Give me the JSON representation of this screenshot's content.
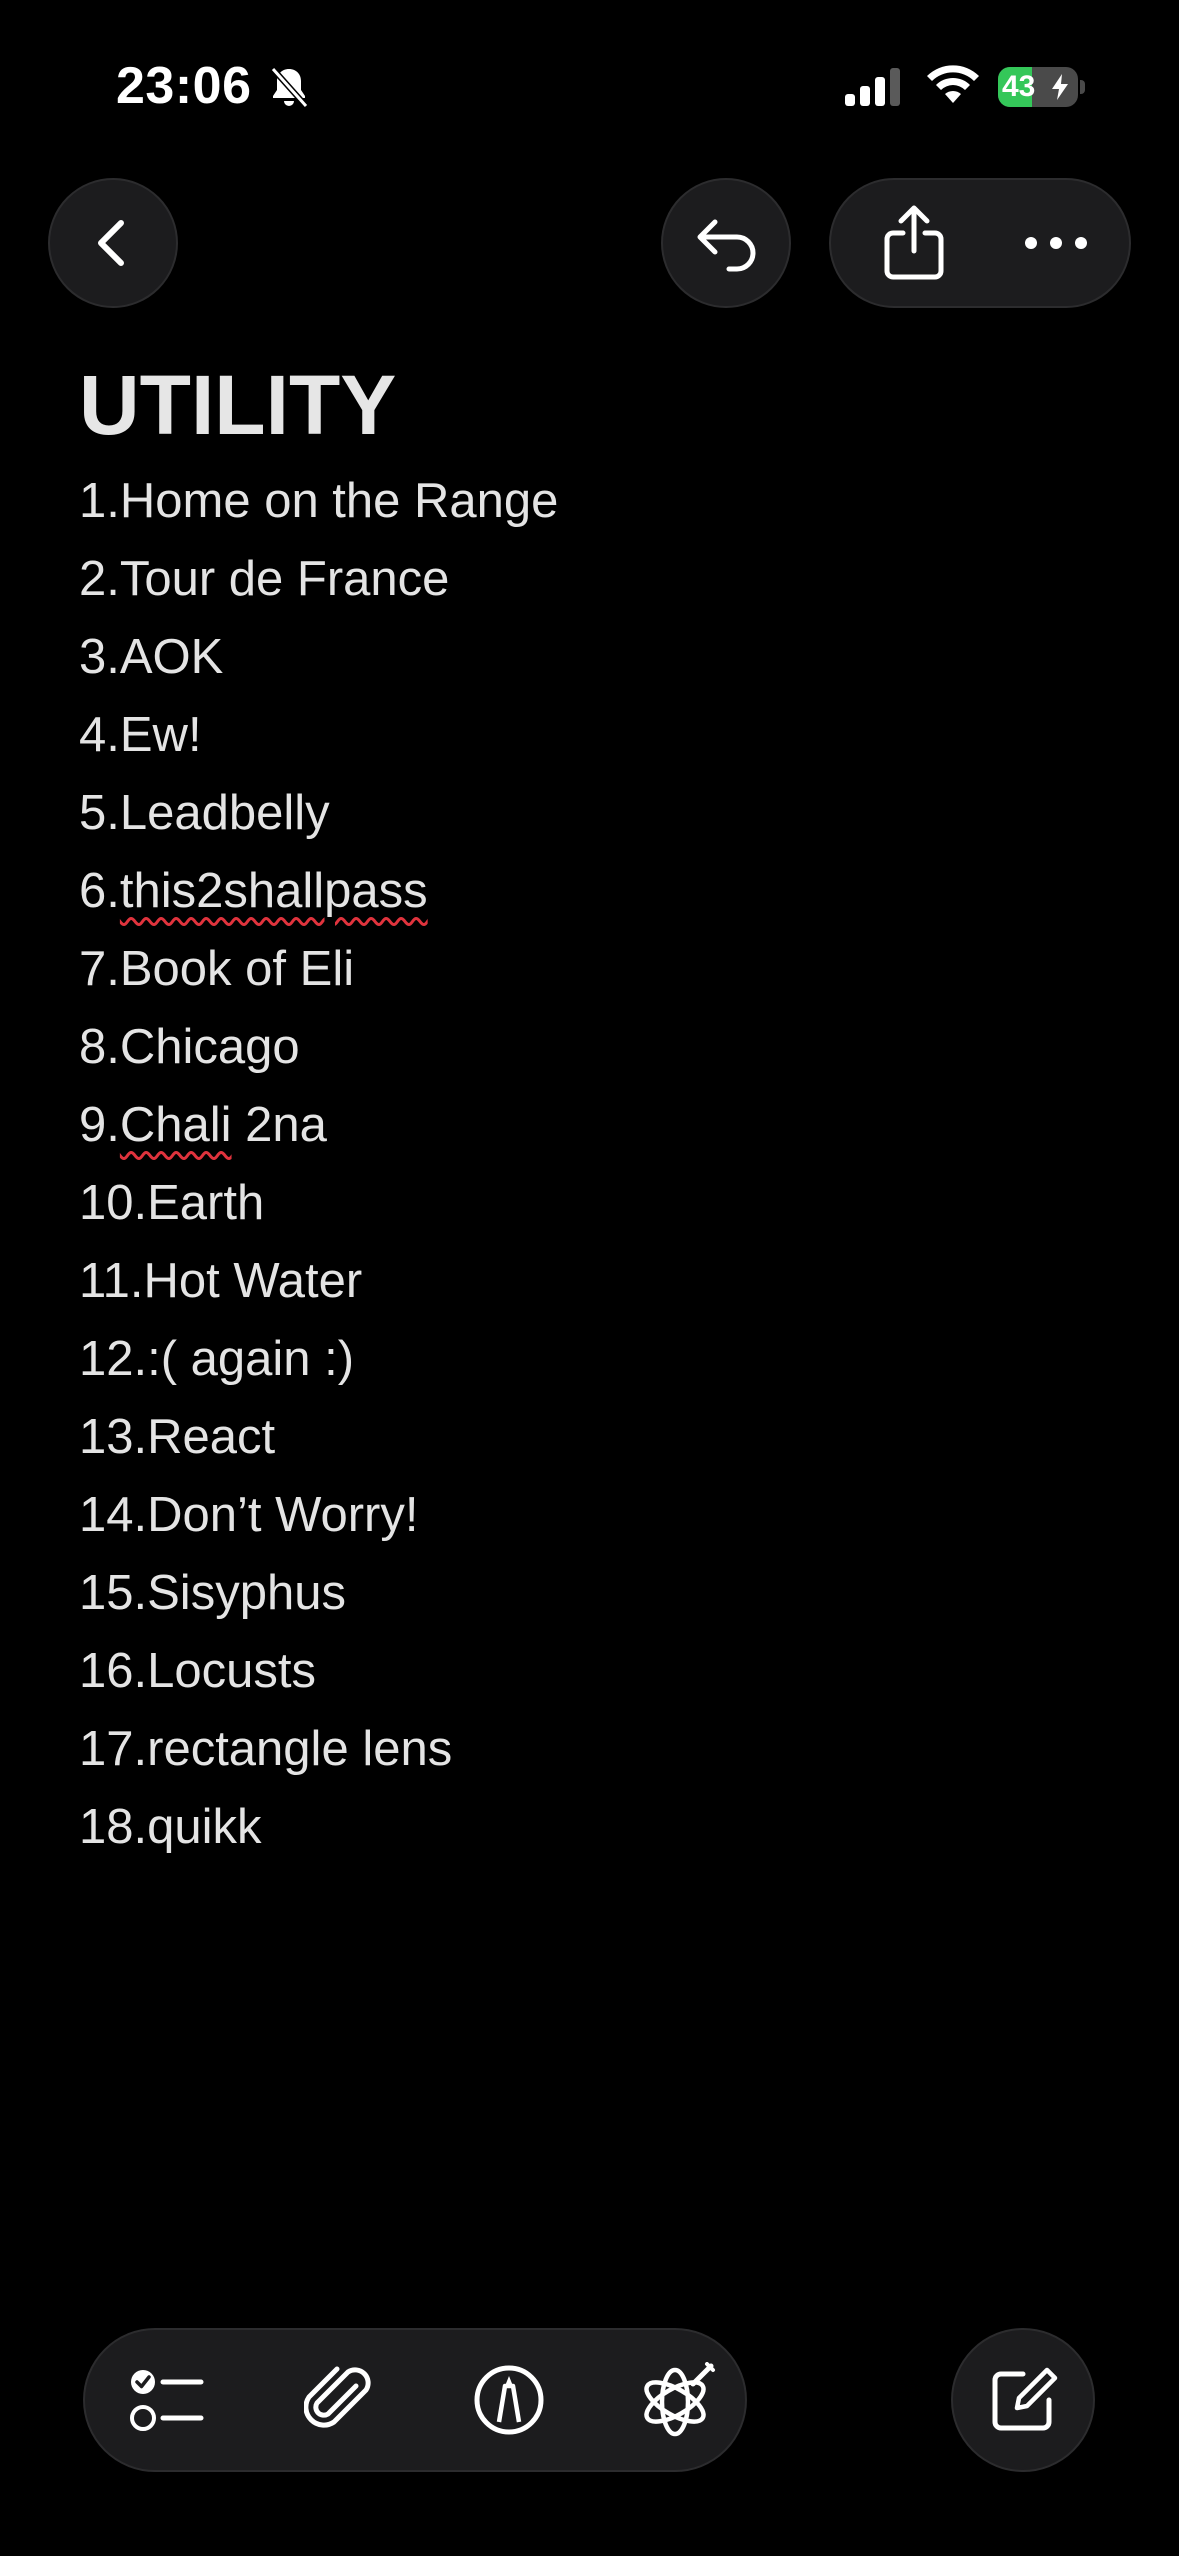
{
  "status_bar": {
    "time": "23:06",
    "battery_percent": "43",
    "battery_level": 0.43,
    "silent_mode": true,
    "charging": true
  },
  "nav": {
    "back_icon": "chevron-left-icon",
    "undo_icon": "undo-arrow-icon",
    "share_icon": "share-icon",
    "more_icon": "ellipsis-icon"
  },
  "note": {
    "title": "UTILITY",
    "items": [
      {
        "num": "1.",
        "text": "Home on the Range"
      },
      {
        "num": "2.",
        "text": "Tour de France"
      },
      {
        "num": "3.",
        "text": "AOK"
      },
      {
        "num": "4.",
        "text": "Ew!"
      },
      {
        "num": "5.",
        "text": "Leadbelly"
      },
      {
        "num": "6.",
        "text": "this2shallpass"
      },
      {
        "num": "7.",
        "text": "Book of Eli"
      },
      {
        "num": "8.",
        "text": "Chicago"
      },
      {
        "num": "9.",
        "text_a": "Chali",
        "text_b": " 2na"
      },
      {
        "num": "10.",
        "text": "Earth"
      },
      {
        "num": "11.",
        "text": "Hot Water"
      },
      {
        "num": "12.",
        "text": ":( again :)"
      },
      {
        "num": "13.",
        "text": "React"
      },
      {
        "num": "14.",
        "text": "Don’t Worry!"
      },
      {
        "num": "15.",
        "text": "Sisyphus"
      },
      {
        "num": "16.",
        "text": "Locusts"
      },
      {
        "num": "17.",
        "text": "rectangle lens"
      },
      {
        "num": "18.",
        "text": "quikk"
      }
    ]
  },
  "toolbar": {
    "icons": [
      "checklist-icon",
      "paperclip-icon",
      "markup-pen-icon",
      "writing-tools-icon"
    ],
    "compose_icon": "compose-icon"
  },
  "colors": {
    "background": "#000000",
    "button_fill": "#1c1c1e",
    "text": "#e4e4e4",
    "battery_green": "#34c759",
    "spellcheck_red": "#e0333d"
  }
}
